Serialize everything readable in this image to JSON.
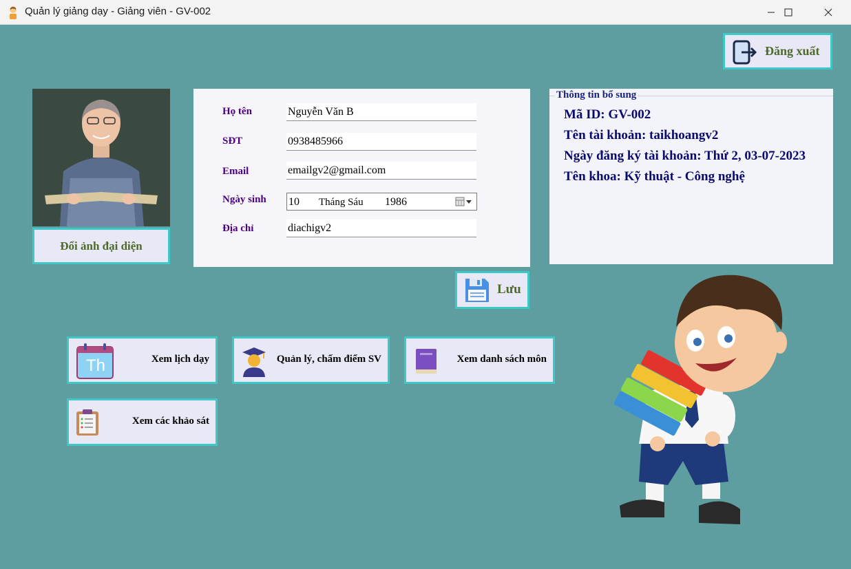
{
  "window": {
    "title": "Quản lý giảng dạy - Giảng viên - GV-002",
    "minimize": "—",
    "maximize": "☐",
    "close": "✕"
  },
  "header": {
    "logout_label": "Đăng xuất",
    "logout_icon": "logout-icon"
  },
  "avatar": {
    "change_label": "Đổi ảnh đại diện",
    "image": "teacher-photo"
  },
  "form": {
    "name_label": "Họ tên",
    "name_value": "Nguyễn Văn B",
    "phone_label": "SĐT",
    "phone_value": "0938485966",
    "email_label": "Email",
    "email_value": "emailgv2@gmail.com",
    "dob_label": "Ngày sinh",
    "dob_day": "10",
    "dob_month": "Tháng Sáu",
    "dob_year": "1986",
    "address_label": "Địa chỉ",
    "address_value": "diachigv2",
    "save_label": "Lưu"
  },
  "info": {
    "legend": "Thông tin bổ sung",
    "id_line": "Mã ID: GV-002",
    "account_line": "Tên tài khoản: taikhoangv2",
    "registered_line": "Ngày đăng ký tài khoản: Thứ 2, 03-07-2023",
    "faculty_line": "Tên khoa: Kỹ thuật - Công nghệ"
  },
  "actions": [
    {
      "label": "Xem lịch dạy",
      "icon": "calendar-icon",
      "icon_text": "Th"
    },
    {
      "label": "Quản lý, chấm điểm SV",
      "icon": "graduate-icon"
    },
    {
      "label": "Xem danh sách môn",
      "icon": "book-icon"
    },
    {
      "label": "Xem các khảo sát",
      "icon": "clipboard-icon"
    }
  ],
  "colors": {
    "background": "#5f9ea0",
    "button_border": "#40c8c8",
    "button_fill": "#e8e8f6",
    "label_purple": "#4b0082",
    "info_text": "#0a0a6e",
    "olive_text": "#4e6a2a"
  }
}
